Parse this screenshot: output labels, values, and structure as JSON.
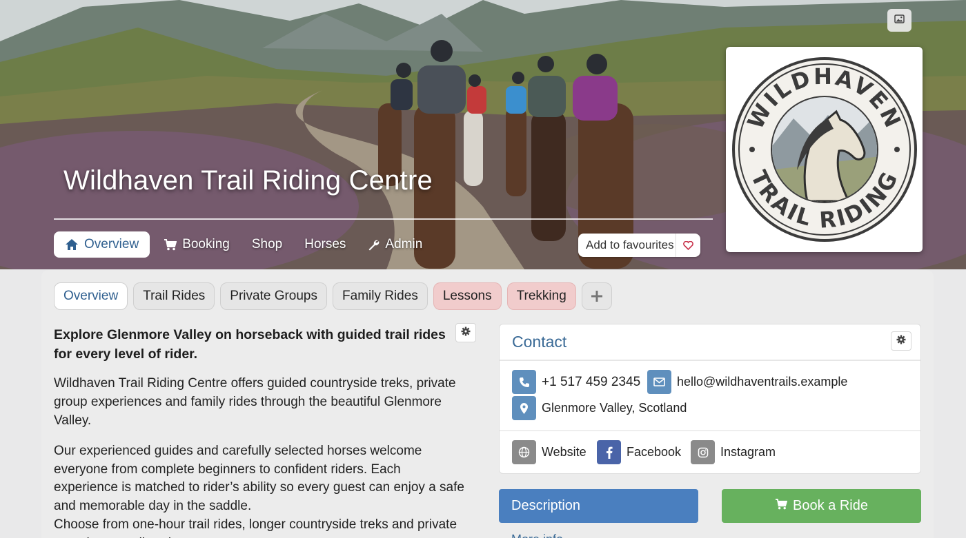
{
  "hero": {
    "title": "Wildhaven Trail Riding Centre",
    "image_alt": "Group of riders on horseback on a heather-lined valley trail",
    "nav": [
      {
        "label": "Overview",
        "icon": "home-icon",
        "active": true
      },
      {
        "label": "Booking",
        "icon": "cart-icon",
        "active": false
      },
      {
        "label": "Shop",
        "icon": "",
        "active": false
      },
      {
        "label": "Horses",
        "icon": "",
        "active": false
      },
      {
        "label": "Admin",
        "icon": "wrench-icon",
        "active": false
      }
    ],
    "favourite_label": "Add to favourites",
    "favourite_icon": "heart-icon",
    "image_button_icon": "image-icon"
  },
  "logo": {
    "top_text": "WILDHAVEN",
    "bottom_text": "TRAIL RIDING"
  },
  "tabs": [
    {
      "label": "Overview",
      "state": "active"
    },
    {
      "label": "Trail Rides",
      "state": "normal"
    },
    {
      "label": "Private Groups",
      "state": "normal"
    },
    {
      "label": "Family Rides",
      "state": "normal"
    },
    {
      "label": "Lessons",
      "state": "highlight"
    },
    {
      "label": "Trekking",
      "state": "highlight"
    }
  ],
  "add_tab_icon": "plus-icon",
  "overview": {
    "lead": "Explore Glenmore Valley on horseback with guided trail rides for every level of rider.",
    "p1": "Wildhaven Trail Riding Centre offers guided countryside treks, private group experiences and family rides through the beautiful Glenmore Valley.",
    "p2": "Our experienced guides and carefully selected horses welcome everyone from complete beginners to confident riders. Each experience is matched to rider’s ability so every guest can enjoy a safe and memorable day in the saddle.",
    "p3": "Choose from one-hour trail rides, longer countryside treks and private experiences tailored to your group."
  },
  "contact": {
    "title": "Contact",
    "phone": "+1 517 459 2345",
    "email": "hello@wildhaventrails.example",
    "location": "Glenmore Valley, Scotland",
    "website_label": "Website",
    "facebook_label": "Facebook",
    "instagram_label": "Instagram"
  },
  "actions": {
    "description_label": "Description",
    "book_label": "Book a Ride",
    "more_info_label": "More info"
  },
  "colors": {
    "accent": "#2f5f8f",
    "book_green": "#67b15e",
    "description_blue": "#4a7fbf",
    "tab_highlight": "#f1cccc"
  }
}
